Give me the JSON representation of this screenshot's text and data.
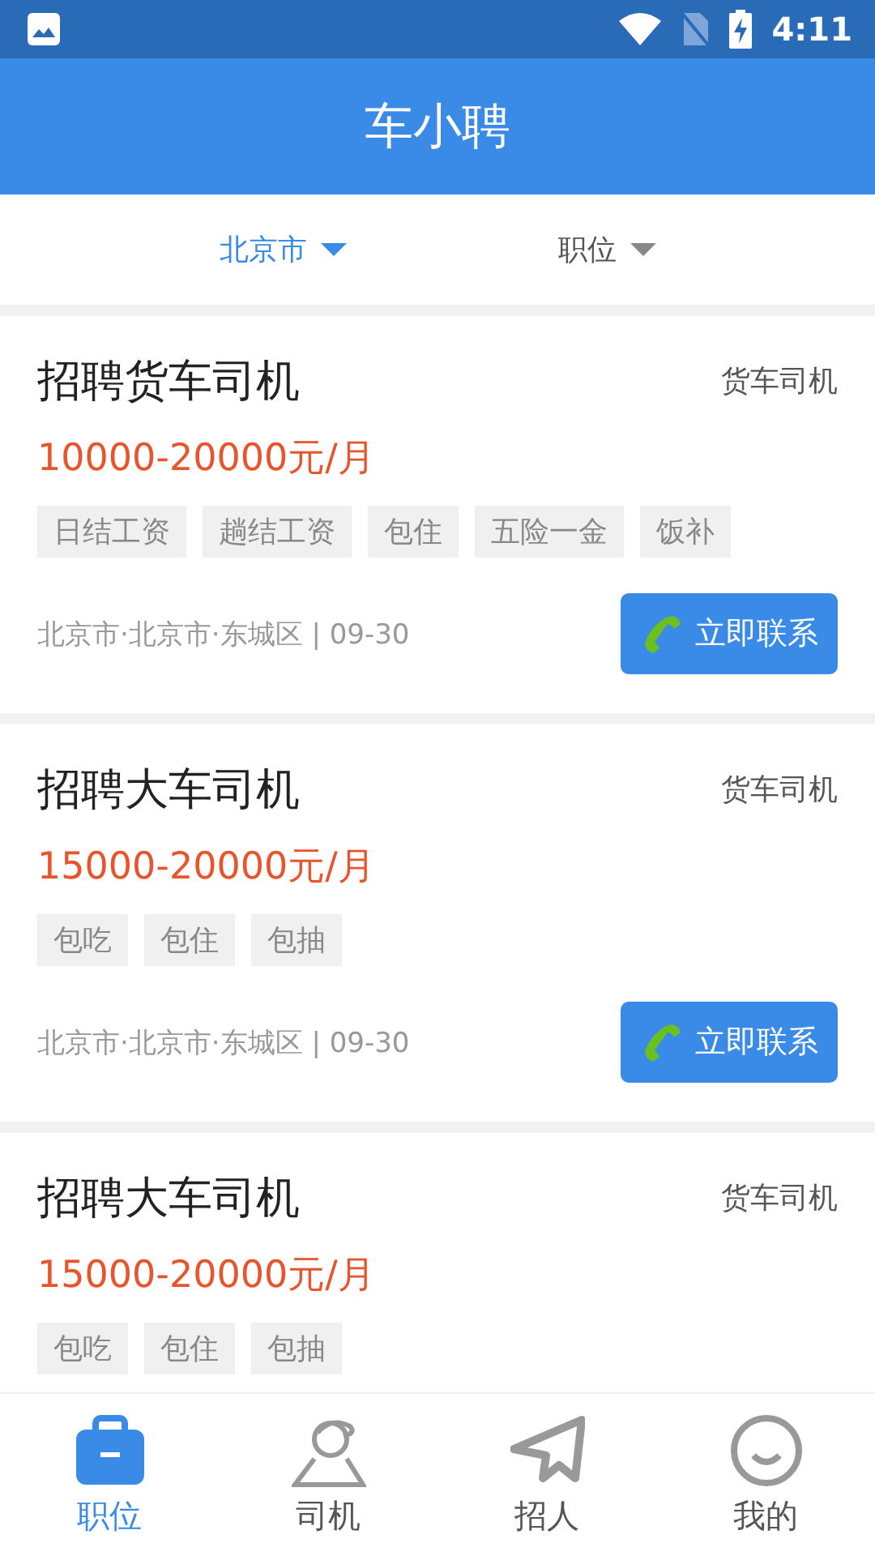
{
  "status_bar": {
    "time": "4:11"
  },
  "header": {
    "title": "车小聘"
  },
  "filters": [
    {
      "label": "北京市",
      "selected": true
    },
    {
      "label": "职位",
      "selected": false
    }
  ],
  "jobs": [
    {
      "title": "招聘货车司机",
      "category": "货车司机",
      "salary": "10000-20000元/月",
      "tags": [
        "日结工资",
        "趟结工资",
        "包住",
        "五险一金",
        "饭补"
      ],
      "location": "北京市·北京市·东城区 | 09-30",
      "button": "立即联系"
    },
    {
      "title": "招聘大车司机",
      "category": "货车司机",
      "salary": "15000-20000元/月",
      "tags": [
        "包吃",
        "包住",
        "包抽"
      ],
      "location": "北京市·北京市·东城区 | 09-30",
      "button": "立即联系"
    },
    {
      "title": "招聘大车司机",
      "category": "货车司机",
      "salary": "15000-20000元/月",
      "tags": [
        "包吃",
        "包住",
        "包抽"
      ]
    }
  ],
  "tab_bar": [
    {
      "label": "职位",
      "kind": "briefcase",
      "selected": true
    },
    {
      "label": "司机",
      "kind": "driver",
      "selected": false
    },
    {
      "label": "招人",
      "kind": "plane",
      "selected": false
    },
    {
      "label": "我的",
      "kind": "smile",
      "selected": false
    }
  ]
}
